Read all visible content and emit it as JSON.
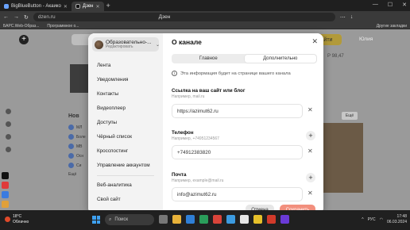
{
  "browser": {
    "tabs": [
      {
        "label": "BigBlueButton - Акаико",
        "active": false
      },
      {
        "label": "Дзен",
        "active": true
      }
    ],
    "address": "dzen.ru",
    "page_title": "Дзен",
    "bookmarks": [
      "БАРС.Web-Образ...",
      "Программное о..."
    ],
    "bookmarks_right": "Другие закладки"
  },
  "background": {
    "search_button": "айти",
    "user_name": "Юлия",
    "stock": "Р 98,47",
    "news_heading": "Нов",
    "ego_label": "Ещё",
    "rows": [
      "МЛ",
      "Боле",
      "МВ",
      "Осн",
      "Си",
      "Ещё"
    ]
  },
  "modal": {
    "profile": {
      "name": "Образовательно-...",
      "edit": "Редактировать"
    },
    "menu": [
      "Лента",
      "Уведомления",
      "Контакты",
      "Видеоплеер",
      "Доступы",
      "Чёрный список",
      "Кросспостинг",
      "Управление аккаунтом"
    ],
    "menu_bottom": [
      "Веб-аналитика",
      "Свой сайт"
    ],
    "title": "О канале",
    "segments": [
      "Главное",
      "Дополнительно"
    ],
    "active_segment": "Дополнительно",
    "info_text": "Эта информация будет на странице вашего канала",
    "fields": {
      "site": {
        "label": "Ссылка на ваш сайт или блог",
        "hint": "Например, mail.ru",
        "value": "https://azimut62.ru"
      },
      "phone": {
        "label": "Телефон",
        "hint": "Например, +74951234567",
        "value": "+74912383820"
      },
      "email": {
        "label": "Почта",
        "hint": "Например, example@mail.ru",
        "value": "info@azimut62.ru"
      }
    },
    "cancel": "Отмена",
    "save": "Сохранить"
  },
  "taskbar": {
    "weather_temp": "18°C",
    "weather_desc": "Облачно",
    "search_placeholder": "Поиск",
    "lang": "РУС",
    "time": "17:48",
    "date": "06.03.2024"
  },
  "colors": {
    "accent_yellow": "#b29a3a",
    "save_button": "#f28f7d"
  }
}
